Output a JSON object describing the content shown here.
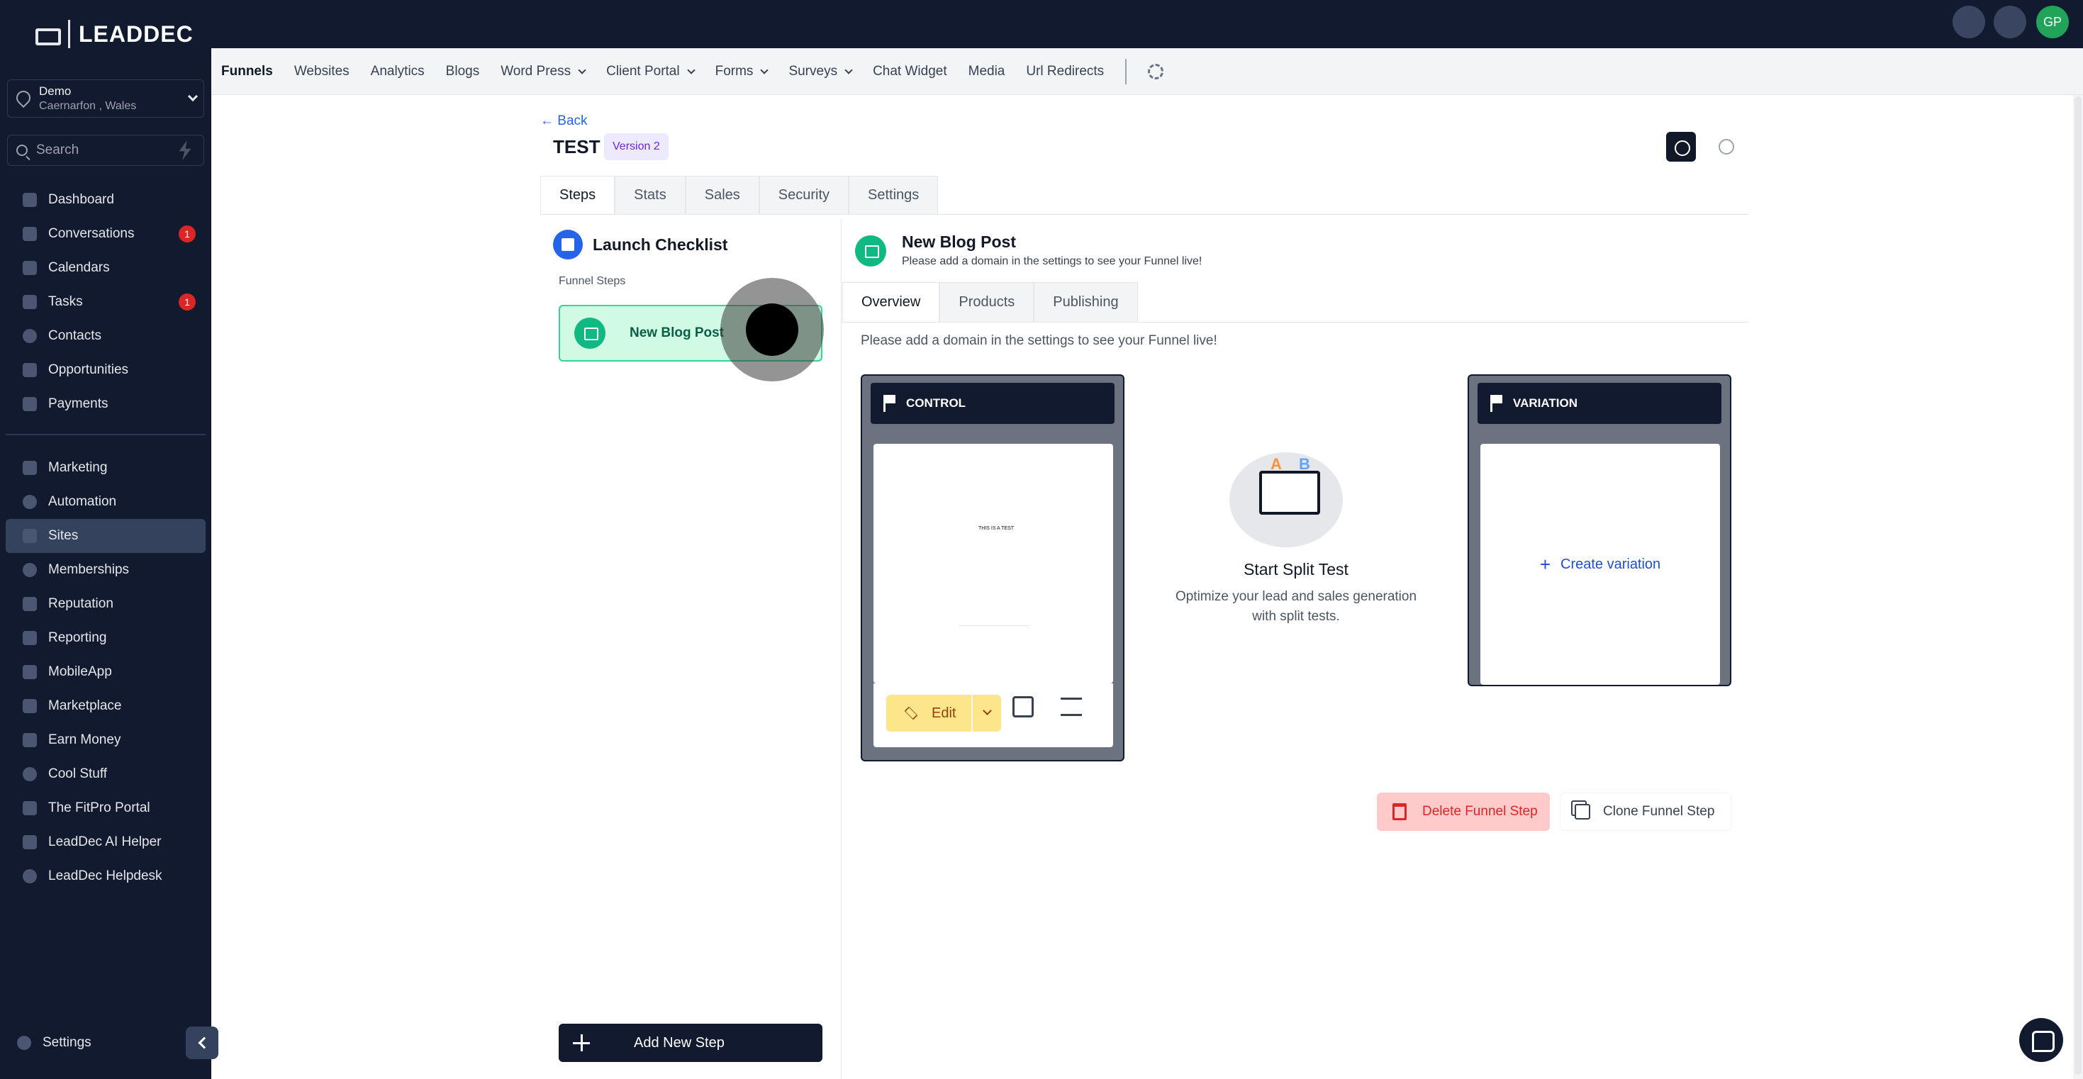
{
  "brand": {
    "name": "LEADDEC"
  },
  "location": {
    "name": "Demo",
    "address": "Caernarfon , Wales"
  },
  "search": {
    "placeholder": "Search"
  },
  "sidebar": {
    "items": [
      {
        "label": "Dashboard"
      },
      {
        "label": "Conversations",
        "badge": "1"
      },
      {
        "label": "Calendars"
      },
      {
        "label": "Tasks",
        "badge": "1"
      },
      {
        "label": "Contacts"
      },
      {
        "label": "Opportunities"
      },
      {
        "label": "Payments"
      },
      {
        "label": "Marketing"
      },
      {
        "label": "Automation"
      },
      {
        "label": "Sites",
        "active": true
      },
      {
        "label": "Memberships"
      },
      {
        "label": "Reputation"
      },
      {
        "label": "Reporting"
      },
      {
        "label": "MobileApp"
      },
      {
        "label": "Marketplace"
      },
      {
        "label": "Earn Money"
      },
      {
        "label": "Cool Stuff"
      },
      {
        "label": "The FitPro Portal"
      },
      {
        "label": "LeadDec AI Helper"
      },
      {
        "label": "LeadDec Helpdesk"
      }
    ],
    "settings_label": "Settings"
  },
  "topbar": {
    "avatar_initials": "GP"
  },
  "subnav": {
    "items": [
      "Funnels",
      "Websites",
      "Analytics",
      "Blogs",
      "Word Press",
      "Client Portal",
      "Forms",
      "Surveys",
      "Chat Widget",
      "Media",
      "Url Redirects"
    ]
  },
  "page": {
    "back_label": "← Back",
    "title": "TEST",
    "version_badge": "Version 2",
    "tabs": [
      "Steps",
      "Stats",
      "Sales",
      "Security",
      "Settings"
    ]
  },
  "checklist": {
    "title": "Launch Checklist",
    "funnel_steps_label": "Funnel Steps",
    "step_label": "New Blog Post",
    "add_step_label": "Add New Step"
  },
  "step_detail": {
    "title": "New Blog Post",
    "subtitle": "Please add a domain in the settings to see your Funnel live!",
    "tabs": [
      "Overview",
      "Products",
      "Publishing"
    ],
    "domain_message": "Please add a domain in the settings to see your Funnel live!",
    "control_label": "CONTROL",
    "preview_text": "THIS IS A TEST",
    "edit_label": "Edit",
    "variation_label": "VARIATION",
    "create_variation_label": "Create variation",
    "split_a": "A",
    "split_b": "B",
    "split_title": "Start Split Test",
    "split_desc": "Optimize your lead and sales generation with split tests.",
    "delete_label": "Delete Funnel Step",
    "clone_label": "Clone Funnel Step"
  }
}
